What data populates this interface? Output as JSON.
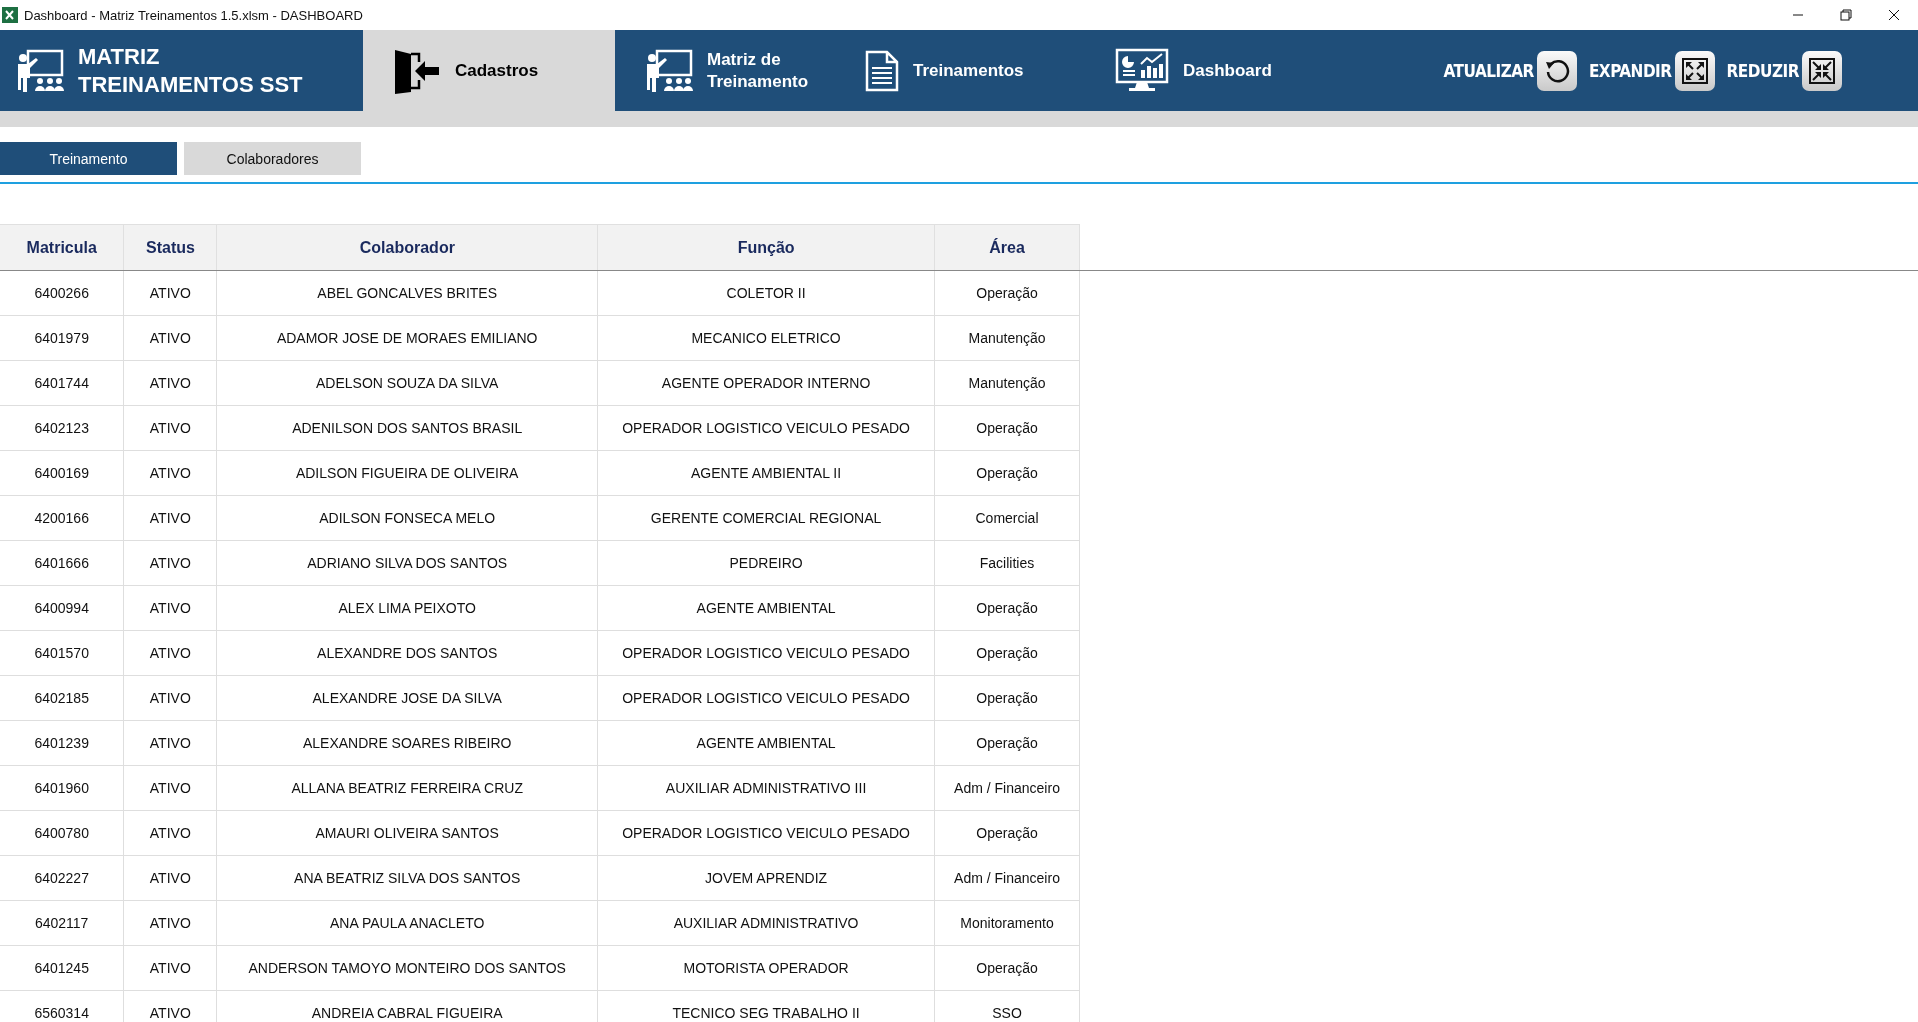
{
  "window": {
    "title": "Dashboard - Matriz Treinamentos 1.5.xlsm - DASHBOARD"
  },
  "nav": {
    "logo": {
      "lines": [
        "MATRIZ",
        "TREINAMENTOS SST"
      ]
    },
    "items": [
      {
        "label": "Cadastros",
        "selected": true
      },
      {
        "label": "Matriz de Treinamento",
        "selected": false
      },
      {
        "label": "Treinamentos",
        "selected": false
      },
      {
        "label": "Dashboard",
        "selected": false
      }
    ],
    "actions": [
      {
        "label": "ATUALIZAR"
      },
      {
        "label": "EXPANDIR"
      },
      {
        "label": "REDUZIR"
      }
    ]
  },
  "subtabs": [
    {
      "label": "Treinamento",
      "selected": true
    },
    {
      "label": "Colaboradores",
      "selected": false
    }
  ],
  "table": {
    "columns": [
      "Matricula",
      "Status",
      "Colaborador",
      "Função",
      "Área"
    ],
    "rows": [
      [
        "6400266",
        "ATIVO",
        "ABEL GONCALVES BRITES",
        "COLETOR II",
        "Operação"
      ],
      [
        "6401979",
        "ATIVO",
        "ADAMOR JOSE DE MORAES EMILIANO",
        "MECANICO ELETRICO",
        "Manutenção"
      ],
      [
        "6401744",
        "ATIVO",
        "ADELSON SOUZA DA SILVA",
        "AGENTE OPERADOR INTERNO",
        "Manutenção"
      ],
      [
        "6402123",
        "ATIVO",
        "ADENILSON DOS SANTOS BRASIL",
        "OPERADOR LOGISTICO VEICULO PESADO",
        "Operação"
      ],
      [
        "6400169",
        "ATIVO",
        "ADILSON FIGUEIRA DE OLIVEIRA",
        "AGENTE AMBIENTAL II",
        "Operação"
      ],
      [
        "4200166",
        "ATIVO",
        "ADILSON FONSECA MELO",
        "GERENTE COMERCIAL REGIONAL",
        "Comercial"
      ],
      [
        "6401666",
        "ATIVO",
        "ADRIANO SILVA DOS SANTOS",
        "PEDREIRO",
        "Facilities"
      ],
      [
        "6400994",
        "ATIVO",
        "ALEX LIMA PEIXOTO",
        "AGENTE AMBIENTAL",
        "Operação"
      ],
      [
        "6401570",
        "ATIVO",
        "ALEXANDRE DOS SANTOS",
        "OPERADOR LOGISTICO VEICULO PESADO",
        "Operação"
      ],
      [
        "6402185",
        "ATIVO",
        "ALEXANDRE JOSE DA SILVA",
        "OPERADOR LOGISTICO VEICULO PESADO",
        "Operação"
      ],
      [
        "6401239",
        "ATIVO",
        "ALEXANDRE SOARES RIBEIRO",
        "AGENTE AMBIENTAL",
        "Operação"
      ],
      [
        "6401960",
        "ATIVO",
        "ALLANA BEATRIZ FERREIRA CRUZ",
        "AUXILIAR ADMINISTRATIVO III",
        "Adm / Financeiro"
      ],
      [
        "6400780",
        "ATIVO",
        "AMAURI OLIVEIRA SANTOS",
        "OPERADOR LOGISTICO VEICULO PESADO",
        "Operação"
      ],
      [
        "6402227",
        "ATIVO",
        "ANA BEATRIZ SILVA DOS SANTOS",
        "JOVEM APRENDIZ",
        "Adm / Financeiro"
      ],
      [
        "6402117",
        "ATIVO",
        "ANA PAULA ANACLETO",
        "AUXILIAR ADMINISTRATIVO",
        "Monitoramento"
      ],
      [
        "6401245",
        "ATIVO",
        "ANDERSON TAMOYO MONTEIRO DOS SANTOS",
        "MOTORISTA OPERADOR",
        "Operação"
      ],
      [
        "6560314",
        "ATIVO",
        "ANDREIA CABRAL FIGUEIRA",
        "TECNICO SEG TRABALHO II",
        "SSO"
      ]
    ]
  }
}
